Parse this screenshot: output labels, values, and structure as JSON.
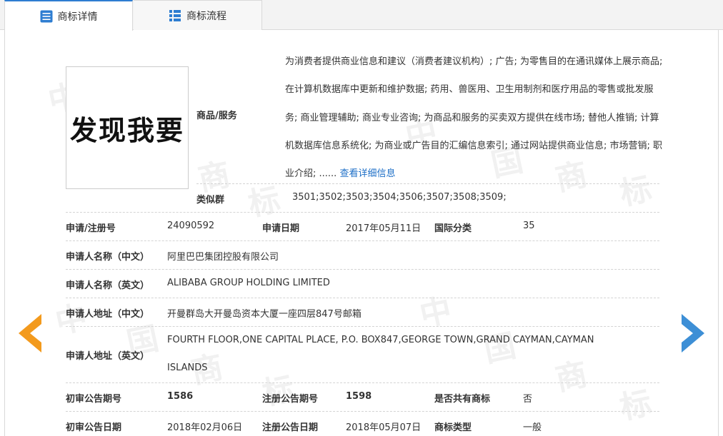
{
  "tabs": [
    {
      "label": "商标详情",
      "active": true
    },
    {
      "label": "商标流程",
      "active": false
    }
  ],
  "logo_text": "发现我要",
  "watermark": [
    "中",
    "国",
    "商",
    "标"
  ],
  "goods": {
    "label": "商品/服务",
    "text": "为消费者提供商业信息和建议（消费者建议机构）; 广告; 为零售目的在通讯媒体上展示商品; 在计算机数据库中更新和维护数据; 药用、兽医用、卫生用制剂和医疗用品的零售或批发服务; 商业管理辅助; 商业专业咨询; 为商品和服务的买卖双方提供在线市场; 替他人推销; 计算机数据库信息系统化; 为商业或广告目的汇编信息索引; 通过网站提供商业信息; 市场营销; 职业介绍; ......",
    "more_link": "查看详细信息"
  },
  "similar_group": {
    "label": "类似群",
    "value": "3501;3502;3503;3504;3506;3507;3508;3509;"
  },
  "reg": {
    "no_label": "申请/注册号",
    "no_value": "24090592",
    "date_label": "申请日期",
    "date_value": "2017年05月11日",
    "class_label": "国际分类",
    "class_value": "35"
  },
  "applicant_cn": {
    "label": "申请人名称（中文）",
    "value": "阿里巴巴集团控股有限公司"
  },
  "applicant_en": {
    "label": "申请人名称（英文）",
    "value": "ALIBABA GROUP HOLDING LIMITED"
  },
  "address_cn": {
    "label": "申请人地址（中文）",
    "value": "开曼群岛大开曼岛资本大厦一座四层847号邮箱"
  },
  "address_en": {
    "label": "申请人地址（英文）",
    "line1": "FOURTH FLOOR,ONE CAPITAL PLACE, P.O. BOX847,GEORGE TOWN,GRAND CAYMAN,CAYMAN",
    "line2": "ISLANDS"
  },
  "pub": {
    "prelim_no_label": "初审公告期号",
    "prelim_no_value": "1586",
    "reg_no_label": "注册公告期号",
    "reg_no_value": "1598",
    "shared_label": "是否共有商标",
    "shared_value": "否"
  },
  "dates": {
    "prelim_date_label": "初审公告日期",
    "prelim_date_value": "2018年02月06日",
    "reg_date_label": "注册公告日期",
    "reg_date_value": "2018年05月07日",
    "type_label": "商标类型",
    "type_value": "一般"
  },
  "colors": {
    "prev_arrow": "#f39a1d",
    "next_arrow": "#3d8fd6",
    "link": "#1e6fc7",
    "tab_accent": "#2e7dd1"
  }
}
